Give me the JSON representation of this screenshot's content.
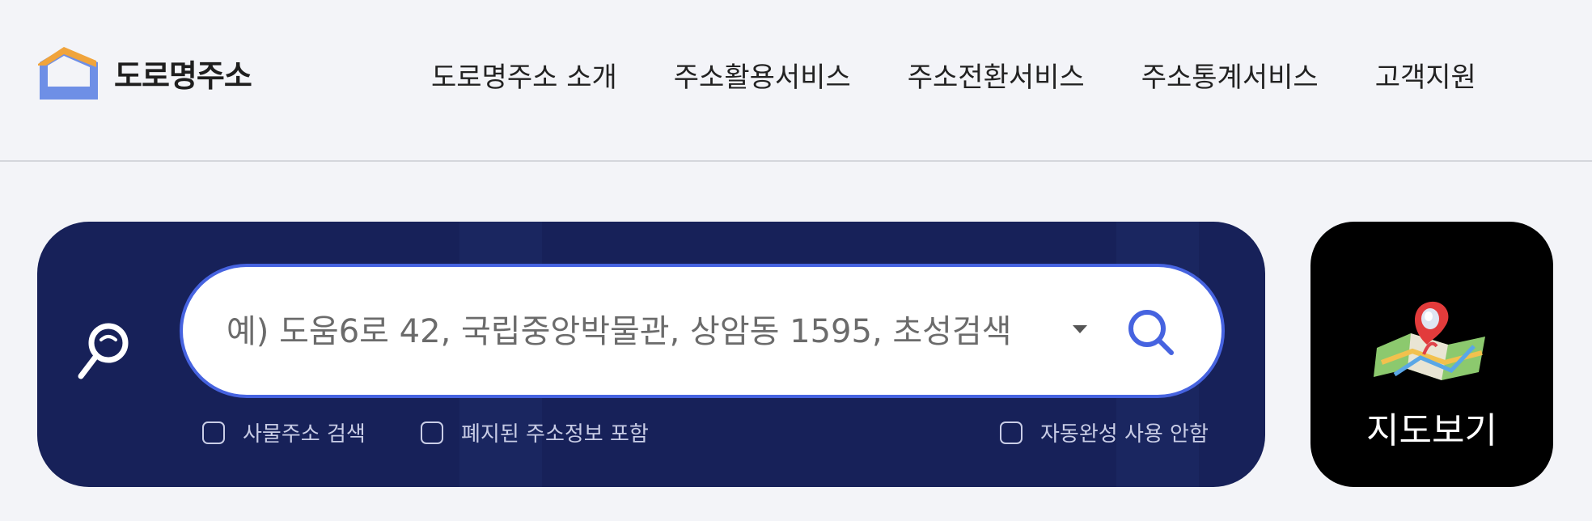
{
  "logo": {
    "text": "도로명주소"
  },
  "nav": {
    "items": [
      {
        "label": "도로명주소 소개"
      },
      {
        "label": "주소활용서비스"
      },
      {
        "label": "주소전환서비스"
      },
      {
        "label": "주소통계서비스"
      },
      {
        "label": "고객지원"
      }
    ]
  },
  "search": {
    "placeholder": "예) 도움6로 42, 국립중앙박물관, 상암동 1595, 초성검색",
    "value": ""
  },
  "options": [
    {
      "label": "사물주소 검색",
      "checked": false
    },
    {
      "label": "폐지된 주소정보 포함",
      "checked": false
    },
    {
      "label": "자동완성 사용 안함",
      "checked": false
    }
  ],
  "map_card": {
    "label": "지도보기"
  },
  "colors": {
    "page_bg": "#f3f4f8",
    "panel_bg": "#172159",
    "search_border": "#4663e0",
    "logo_blue": "#6e8fe6",
    "logo_orange": "#f0a43c"
  },
  "icons": {
    "logo": "house-icon",
    "panel": "magnifier-icon",
    "search_button": "search-icon",
    "map": "map-pin-icon"
  }
}
